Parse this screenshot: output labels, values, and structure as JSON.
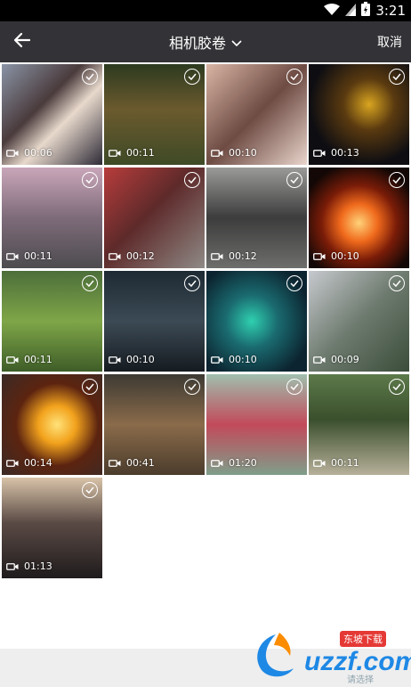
{
  "status_bar": {
    "time": "3:21",
    "icons": [
      "wifi-icon",
      "signal-icon",
      "battery-icon"
    ]
  },
  "app_bar": {
    "back_icon": "back-arrow-icon",
    "title": "相机胶卷",
    "dropdown_icon": "chevron-down-icon",
    "cancel_label": "取消"
  },
  "videos": [
    {
      "duration": "00:06"
    },
    {
      "duration": "00:11"
    },
    {
      "duration": "00:10"
    },
    {
      "duration": "00:13"
    },
    {
      "duration": "00:11"
    },
    {
      "duration": "00:12"
    },
    {
      "duration": "00:12"
    },
    {
      "duration": "00:10"
    },
    {
      "duration": "00:11"
    },
    {
      "duration": "00:10"
    },
    {
      "duration": "00:10"
    },
    {
      "duration": "00:09"
    },
    {
      "duration": "00:14"
    },
    {
      "duration": "00:41"
    },
    {
      "duration": "01:20"
    },
    {
      "duration": "00:11"
    },
    {
      "duration": "01:13"
    }
  ],
  "watermark": {
    "logo_text": "uzzf.com",
    "tag": "东坡下载",
    "sub": "请选择"
  },
  "colors": {
    "app_bar": "#333337",
    "status_bar": "#000000"
  }
}
